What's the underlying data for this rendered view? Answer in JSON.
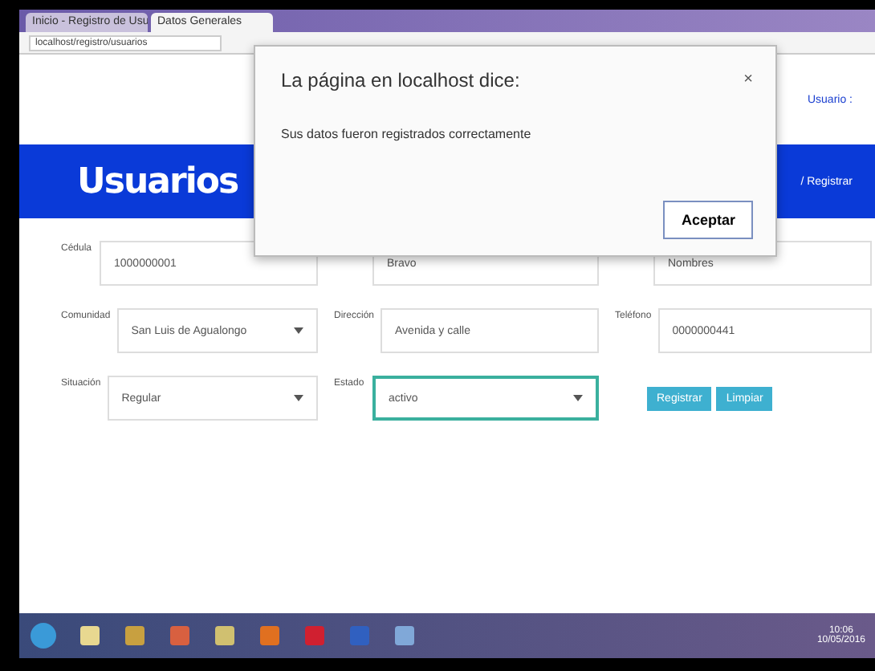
{
  "browser": {
    "tabs": [
      {
        "title": "Inicio - Registro de Usu",
        "selected": false
      },
      {
        "title": "Datos Generales",
        "selected": true
      }
    ],
    "address": "localhost/registro/usuarios"
  },
  "header": {
    "user": "Usuario :"
  },
  "banner": {
    "title": "Usuarios",
    "breadcrumb": "/ Registrar"
  },
  "form": {
    "rows": [
      [
        {
          "kind": "input",
          "label": "Cédula",
          "value": "1000000001"
        },
        {
          "kind": "input",
          "value": "Bravo"
        },
        {
          "kind": "input",
          "value": "Nombres"
        }
      ],
      [
        {
          "kind": "select",
          "label": "Comunidad",
          "value": "San Luis de Agualongo"
        },
        {
          "kind": "input",
          "label": "Dirección",
          "value": "Avenida y calle"
        },
        {
          "kind": "input",
          "label": "Teléfono",
          "value": "0000000441"
        }
      ],
      [
        {
          "kind": "select",
          "label": "Situación",
          "value": "Regular"
        },
        {
          "kind": "select",
          "label": "Estado",
          "value": "activo",
          "focused": true
        },
        {
          "kind": "buttons",
          "buttons": [
            "Registrar",
            "Limpiar"
          ]
        }
      ]
    ]
  },
  "dialog": {
    "title": "La página en localhost dice:",
    "message": "Sus datos fueron registrados correctamente",
    "close": "×",
    "button": "Aceptar"
  },
  "taskbar": {
    "time": "10:06",
    "date": "10/05/2016"
  }
}
